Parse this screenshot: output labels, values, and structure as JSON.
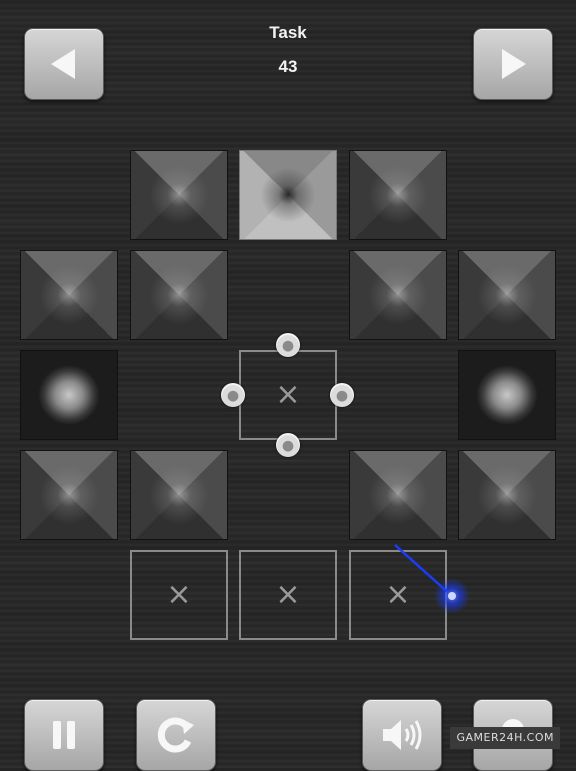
{
  "header": {
    "title": "Task",
    "task_number": "43"
  },
  "nav": {
    "prev_icon": "triangle-left-icon",
    "next_icon": "triangle-right-icon"
  },
  "board": {
    "rows": [
      [
        "empty",
        "tile",
        "tile-inverted",
        "tile",
        "empty"
      ],
      [
        "tile",
        "tile",
        "empty",
        "tile",
        "tile"
      ],
      [
        "orb",
        "empty",
        "target",
        "empty",
        "orb"
      ],
      [
        "tile",
        "tile",
        "empty",
        "tile",
        "tile"
      ],
      [
        "empty",
        "slot",
        "slot",
        "slot",
        "empty"
      ]
    ],
    "slot_marker": "×",
    "target_marker": "×"
  },
  "toolbar": {
    "pause_icon": "pause-icon",
    "restart_icon": "restart-icon",
    "sound_icon": "speaker-icon",
    "hint_icon": "lightbulb-icon"
  },
  "watermark": "GAMER24H.COM",
  "colors": {
    "background": "#262626",
    "button": "#c4c4c4",
    "laser": "#1a3cff"
  }
}
